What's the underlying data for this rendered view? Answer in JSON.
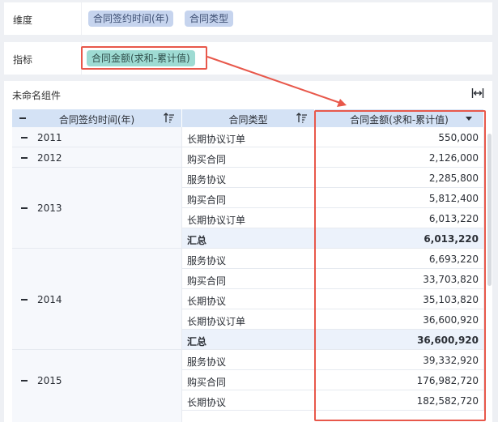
{
  "dimension_row": {
    "label": "维度",
    "chips": [
      "合同签约时间(年)",
      "合同类型"
    ]
  },
  "metric_row": {
    "label": "指标",
    "chips": [
      "合同金额(求和-累计值)"
    ]
  },
  "component": {
    "title": "未命名组件",
    "fit_icon": "fit-width-icon",
    "headers": [
      "合同签约时间(年)",
      "合同类型",
      "合同金额(求和-累计值)"
    ],
    "groups": [
      {
        "year": "2011",
        "rows": [
          {
            "type": "长期协议订单",
            "value": "550,000"
          }
        ]
      },
      {
        "year": "2012",
        "rows": [
          {
            "type": "购买合同",
            "value": "2,126,000"
          }
        ]
      },
      {
        "year": "2013",
        "rows": [
          {
            "type": "服务协议",
            "value": "2,285,800"
          },
          {
            "type": "购买合同",
            "value": "5,812,400"
          },
          {
            "type": "长期协议订单",
            "value": "6,013,220"
          },
          {
            "type": "汇总",
            "value": "6,013,220",
            "subtotal": true
          }
        ]
      },
      {
        "year": "2014",
        "rows": [
          {
            "type": "服务协议",
            "value": "6,693,220"
          },
          {
            "type": "购买合同",
            "value": "33,703,820"
          },
          {
            "type": "长期协议",
            "value": "35,103,820"
          },
          {
            "type": "长期协议订单",
            "value": "36,600,920"
          },
          {
            "type": "汇总",
            "value": "36,600,920",
            "subtotal": true
          }
        ]
      },
      {
        "year": "2015",
        "rows": [
          {
            "type": "服务协议",
            "value": "39,332,920"
          },
          {
            "type": "购买合同",
            "value": "176,982,720"
          },
          {
            "type": "长期协议",
            "value": "182,582,720"
          }
        ]
      }
    ]
  },
  "colors": {
    "accent_red": "#e8584b",
    "header_bg": "#d4e2f5",
    "chip_blue": "#c6d4ee",
    "chip_teal": "#9edbd3"
  }
}
